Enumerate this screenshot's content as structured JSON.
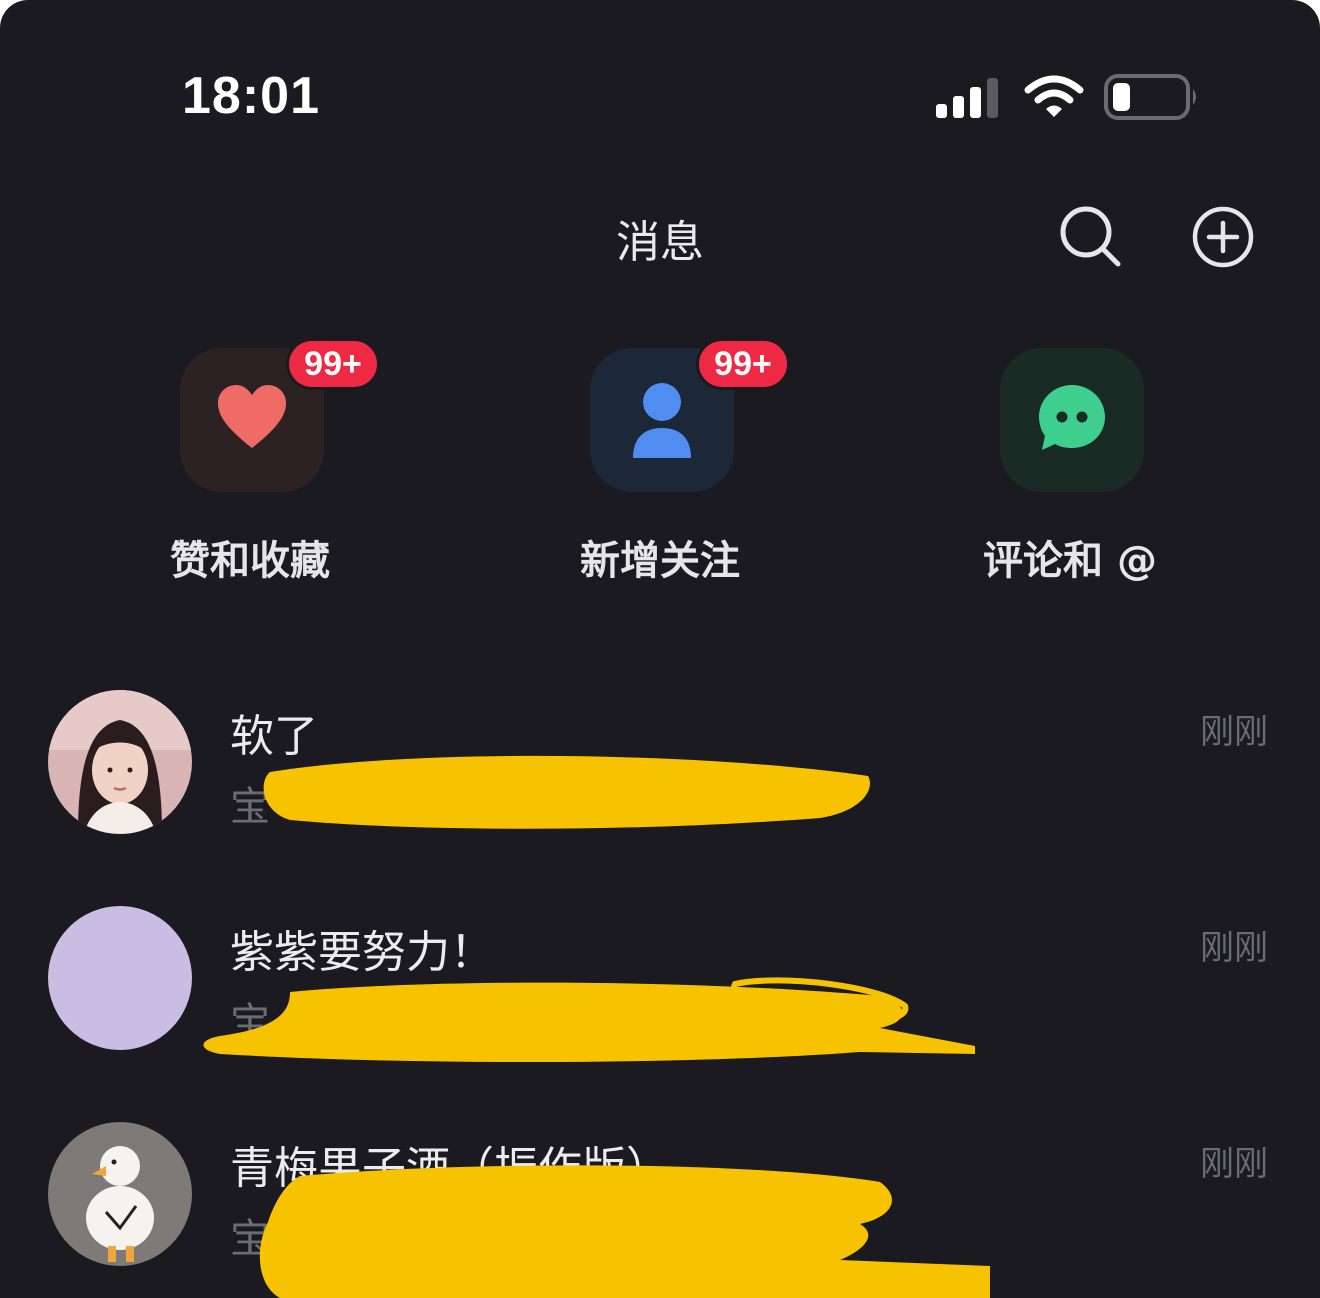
{
  "status_bar": {
    "time": "18:01"
  },
  "header": {
    "title": "消息",
    "search_icon": "search-icon",
    "add_icon": "plus-circle-icon"
  },
  "categories": [
    {
      "label": "赞和收藏",
      "badge": "99+",
      "icon": "heart-icon",
      "color": "#ee6b66"
    },
    {
      "label": "新增关注",
      "badge": "99+",
      "icon": "person-icon",
      "color": "#4f8ef0"
    },
    {
      "label": "评论和 @",
      "icon": "chat-bubble-icon",
      "color": "#3ecf8e"
    }
  ],
  "conversations": [
    {
      "name": "软了",
      "preview": "宝",
      "time": "刚刚"
    },
    {
      "name": "紫紫要努力！",
      "preview": "宝",
      "time": "刚刚"
    },
    {
      "name": "青梅果子酒（振作版）",
      "preview": "宝",
      "time": "刚刚"
    }
  ],
  "colors": {
    "background": "#1a1a20",
    "badge": "#ee2944",
    "redaction": "#f7c300"
  }
}
